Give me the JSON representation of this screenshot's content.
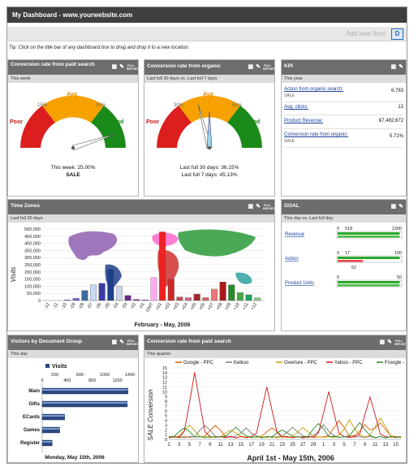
{
  "header": {
    "title": "My Dashboard - www.yourwebsite.com",
    "add_item": "Add new Item",
    "add_icon": "D"
  },
  "tip": "Tip: Click on the title bar of any dashboard box to drag and drop it to a new location.",
  "panel_icons": {
    "trash": "trash-icon",
    "edit": "pencil-icon",
    "full": "FULL REPORT"
  },
  "colors": {
    "title_bg": "#6d6d6d",
    "poor": "#dd1e1e",
    "avg": "#f7a100",
    "good": "#1a8a1a",
    "link": "#1a3f99"
  },
  "gauge1": {
    "title": "Conversion rate from paid search",
    "sub": "This week",
    "labels": {
      "poor": "Poor",
      "avg": "Avg",
      "good": "Good",
      "t1": "15%",
      "t2": "20%"
    },
    "needle": 0.9,
    "line1": "This week: 25.00%",
    "line2": "SALE"
  },
  "gauge2": {
    "title": "Conversion rate from organic",
    "sub": "Last full 30 days vs. Last full 7 days",
    "labels": {
      "poor": "Poor",
      "avg": "Avg",
      "good": "Good",
      "t1": "30%",
      "t2": "50%"
    },
    "needle": 0.42,
    "line1": "Last full 30 days: 36.15%",
    "line2": "Last full 7 days: 45.13%"
  },
  "kpi": {
    "title": "KPI",
    "sub": "This year",
    "rows": [
      {
        "label": "Action from organic search:",
        "sub": "SALE",
        "value": "6,783"
      },
      {
        "label": "Avg. clicks:",
        "sub": "",
        "value": "13"
      },
      {
        "label": "Product Revenue:",
        "sub": "",
        "value": "€7,482,672"
      },
      {
        "label": "Conversion rate from organic:",
        "sub": "SALE",
        "value": "5.71%"
      }
    ]
  },
  "timezones": {
    "title": "Time Zones",
    "sub": "Last full 30 days",
    "chart_data": {
      "type": "bar",
      "ylabel": "Visits",
      "xlabel": "February - May, 2006",
      "ylim": [
        0,
        500000
      ],
      "yticks": [
        "500,000",
        "450,000",
        "400,000",
        "350,000",
        "300,000",
        "250,000",
        "200,000",
        "150,000",
        "100,000",
        "50,000",
        "0"
      ],
      "categories": [
        "-12",
        "-11",
        "-10",
        "-09",
        "-08",
        "-07",
        "-06",
        "-05",
        "-04",
        "-03",
        "-02",
        "-01",
        "GMT",
        "+01",
        "+02",
        "+03",
        "+04",
        "+05",
        "+06",
        "+07",
        "+08",
        "+09",
        "+10",
        "+11",
        "+12"
      ],
      "values": [
        0,
        0,
        5000,
        15000,
        70000,
        110000,
        120000,
        220000,
        100000,
        35000,
        8000,
        5000,
        160000,
        480000,
        150000,
        25000,
        20000,
        45000,
        20000,
        80000,
        130000,
        110000,
        55000,
        40000,
        20000
      ],
      "colors": [
        "#999999",
        "#999999",
        "#6a6ad0",
        "#7a5ac8",
        "#3a6aa0",
        "#c8d8f0",
        "#3a3aaa",
        "#1e3f8a",
        "#ccd4e8",
        "#6a2a8a",
        "#8a2a8a",
        "#cc2acc",
        "#ffaaee",
        "#ee2222",
        "#cc2a2a",
        "#c05050",
        "#cc6688",
        "#a02828",
        "#d06060",
        "#ee7777",
        "#aa1a1a",
        "#2a8a2a",
        "#4aa84a",
        "#20a060",
        "#88cc88"
      ]
    }
  },
  "goal": {
    "title": "GOAL",
    "sub": "This day vs. Last full day",
    "rows": [
      {
        "label": "Revenue",
        "min": "0",
        "mid": "518",
        "max": "1300",
        "fill1": 0.98,
        "fill2": 0.98,
        "under": ""
      },
      {
        "label": "Action",
        "min": "0",
        "mid": "17",
        "max": "100",
        "fill1": 0.98,
        "fill2": 0.4,
        "under": "52"
      },
      {
        "label": "Product Units",
        "min": "0",
        "mid": "",
        "max": "50",
        "fill1": 0.98,
        "fill2": 0.98,
        "under": ""
      }
    ]
  },
  "visitors": {
    "title": "Visitors by Document Group",
    "sub": "This day",
    "chart_data": {
      "type": "bar",
      "series_name": "Visits",
      "categories": [
        "Main",
        "Gifts",
        "ECards",
        "Games",
        "Register"
      ],
      "values": [
        1370,
        1360,
        360,
        280,
        160
      ],
      "xlim": [
        0,
        1400
      ],
      "ticks_top": [
        "200",
        "600",
        "1000",
        "1400"
      ],
      "ticks_bottom": [
        "0",
        "400",
        "800",
        "1200"
      ],
      "xlabel": "Monday, May 15th, 2006"
    }
  },
  "paidsearch": {
    "title": "Conversion rate from paid search",
    "sub": "This quarter",
    "chart_data": {
      "type": "line",
      "ylabel": "SALE Conversion",
      "xlabel": "April 1st - May 15th, 2006",
      "ylim": [
        0,
        15
      ],
      "yticks": [
        "15",
        "14",
        "13",
        "12",
        "11",
        "10",
        "9",
        "8",
        "7",
        "6",
        "5",
        "4",
        "3",
        "2",
        "1",
        "0"
      ],
      "xticks": [
        "1",
        "3",
        "5",
        "7",
        "9",
        "11",
        "13",
        "15",
        "17",
        "19",
        "21",
        "23",
        "25",
        "27",
        "29",
        "1",
        "3",
        "5",
        "7",
        "9",
        "11",
        "13",
        "15"
      ],
      "series": [
        {
          "name": "Google - PPC",
          "color": "#e05a00",
          "peaks": [
            [
              9,
              2.5
            ],
            [
              20,
              2
            ],
            [
              33,
              3.5
            ],
            [
              38,
              2.5
            ],
            [
              41,
              3
            ]
          ]
        },
        {
          "name": "Kelkoo",
          "color": "#777777",
          "peaks": [
            [
              7,
              2.5
            ],
            [
              15,
              1.8
            ],
            [
              24,
              2
            ],
            [
              30,
              2.5
            ]
          ]
        },
        {
          "name": "Overture - PPC",
          "color": "#c8a000",
          "peaks": [
            [
              4,
              2.5
            ],
            [
              12,
              1.5
            ],
            [
              26,
              2
            ],
            [
              35,
              3.5
            ],
            [
              41,
              4
            ]
          ]
        },
        {
          "name": "Yahoo - PPC",
          "color": "#cc1a1a",
          "peaks": [
            [
              5,
              13.5
            ],
            [
              19,
              10.5
            ],
            [
              31,
              9.5
            ],
            [
              39,
              8.5
            ]
          ]
        },
        {
          "name": "Froogle - Na...",
          "color": "#2a8a2a",
          "peaks": [
            [
              3,
              2
            ],
            [
              13,
              2
            ],
            [
              22,
              1.5
            ],
            [
              29,
              3
            ],
            [
              37,
              3
            ]
          ]
        }
      ]
    }
  }
}
